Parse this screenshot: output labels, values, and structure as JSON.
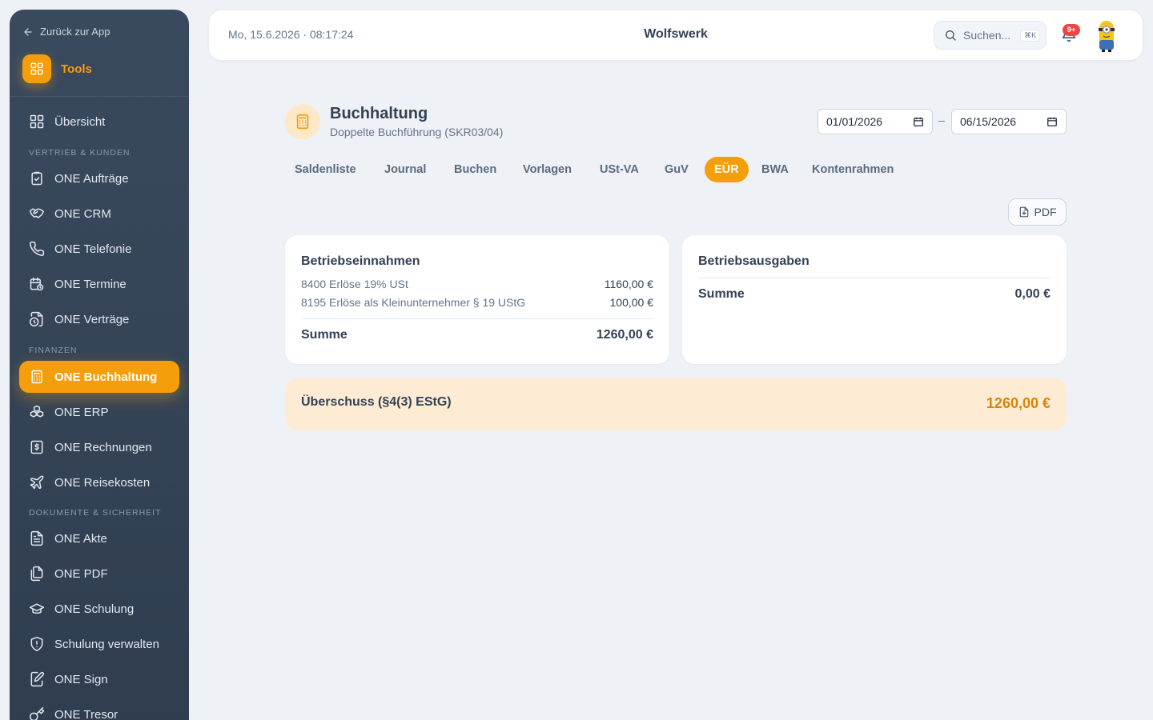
{
  "sidebar": {
    "back_label": "Zurück zur App",
    "tools_label": "Tools",
    "overview_label": "Übersicht",
    "sections": {
      "sales": "Vertrieb & Kunden",
      "finance": "Finanzen",
      "docs": "Dokumente & Sicherheit"
    },
    "items": [
      "ONE Aufträge",
      "ONE CRM",
      "ONE Telefonie",
      "ONE Termine",
      "ONE Verträge",
      "ONE Buchhaltung",
      "ONE ERP",
      "ONE Rechnungen",
      "ONE Reisekosten",
      "ONE Akte",
      "ONE PDF",
      "ONE Schulung",
      "Schulung verwalten",
      "ONE Sign",
      "ONE Tresor"
    ],
    "active_item": "ONE Buchhaltung",
    "accent_color": "#f59e0b"
  },
  "header": {
    "datetime": "Mo, 15.6.2026 · 08:17:24",
    "company": "Wolfswerk",
    "search_placeholder": "Suchen...",
    "search_shortcut": "⌘K",
    "notification_badge": "9+",
    "avatar": "minion-avatar"
  },
  "page": {
    "title": "Buchhaltung",
    "subtitle": "Doppelte Buchführung (SKR03/04)",
    "date_from": "01/01/2026",
    "date_to": "06/15/2026",
    "date_separator": "–",
    "tabs": [
      "Saldenliste",
      "Journal",
      "Buchen",
      "Vorlagen",
      "USt-VA",
      "GuV",
      "EÜR",
      "BWA",
      "Kontenrahmen"
    ],
    "active_tab": "EÜR",
    "pdf_label": "PDF"
  },
  "income": {
    "title": "Betriebseinnahmen",
    "rows": [
      {
        "label": "8400 Erlöse 19% USt",
        "amount": "1160,00 €"
      },
      {
        "label": "8195 Erlöse als Kleinunternehmer § 19 UStG",
        "amount": "100,00 €"
      }
    ],
    "sum_label": "Summe",
    "sum_value": "1260,00 €"
  },
  "expenses": {
    "title": "Betriebsausgaben",
    "sum_label": "Summe",
    "sum_value": "0,00 €"
  },
  "surplus": {
    "label": "Überschuss (§4(3) EStG)",
    "value": "1260,00 €",
    "value_color": "#d9850b"
  }
}
